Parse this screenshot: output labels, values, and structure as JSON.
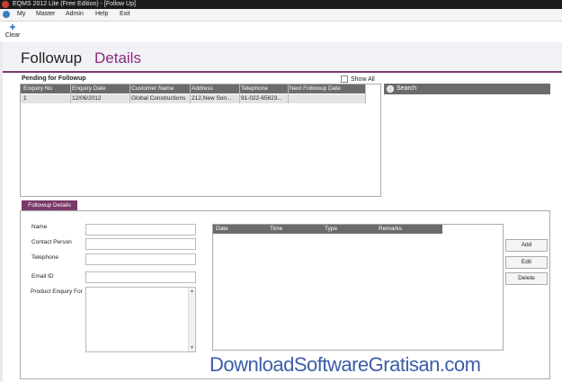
{
  "window": {
    "title": "EQMS 2012 Lite (Free Edition)  - [Follow Up]"
  },
  "menu": [
    "My",
    "Master",
    "Admin",
    "Help",
    "Exit"
  ],
  "toolbar": {
    "clear_label": "Clear",
    "clear_icon": "clear-icon"
  },
  "header": {
    "title_part1": "Followup",
    "title_part2": "Details"
  },
  "pending": {
    "label": "Pending for Followup",
    "show_all_label": "Show All",
    "columns": [
      "Enquiry No",
      "Enquiry Date",
      "Customer Name",
      "Address",
      "Telephone",
      "Next Followup Date"
    ],
    "rows": [
      [
        "1",
        "12/06/2012",
        "Global Constructions",
        "212,New Son...",
        "91-022-65623...",
        ""
      ]
    ]
  },
  "search": {
    "label": "Search"
  },
  "followup": {
    "tab_label": "Followup Details",
    "name_label": "Name",
    "contact_label": "Contact Person",
    "telephone_label": "Telephone",
    "email_label": "Email ID",
    "product_label": "Product Enquiry For",
    "remarks_columns": [
      "Date",
      "Time",
      "Type",
      "Remarks"
    ],
    "buttons": {
      "add": "Add",
      "edit": "Edit",
      "delete": "Delete"
    }
  },
  "watermark": "DownloadSoftwareGratisan.com",
  "colors": {
    "accent": "#8a2c7e",
    "header_tab": "#7a3a6a",
    "grid_header": "#6b6b6b",
    "titlebar": "#1b1b1b"
  }
}
